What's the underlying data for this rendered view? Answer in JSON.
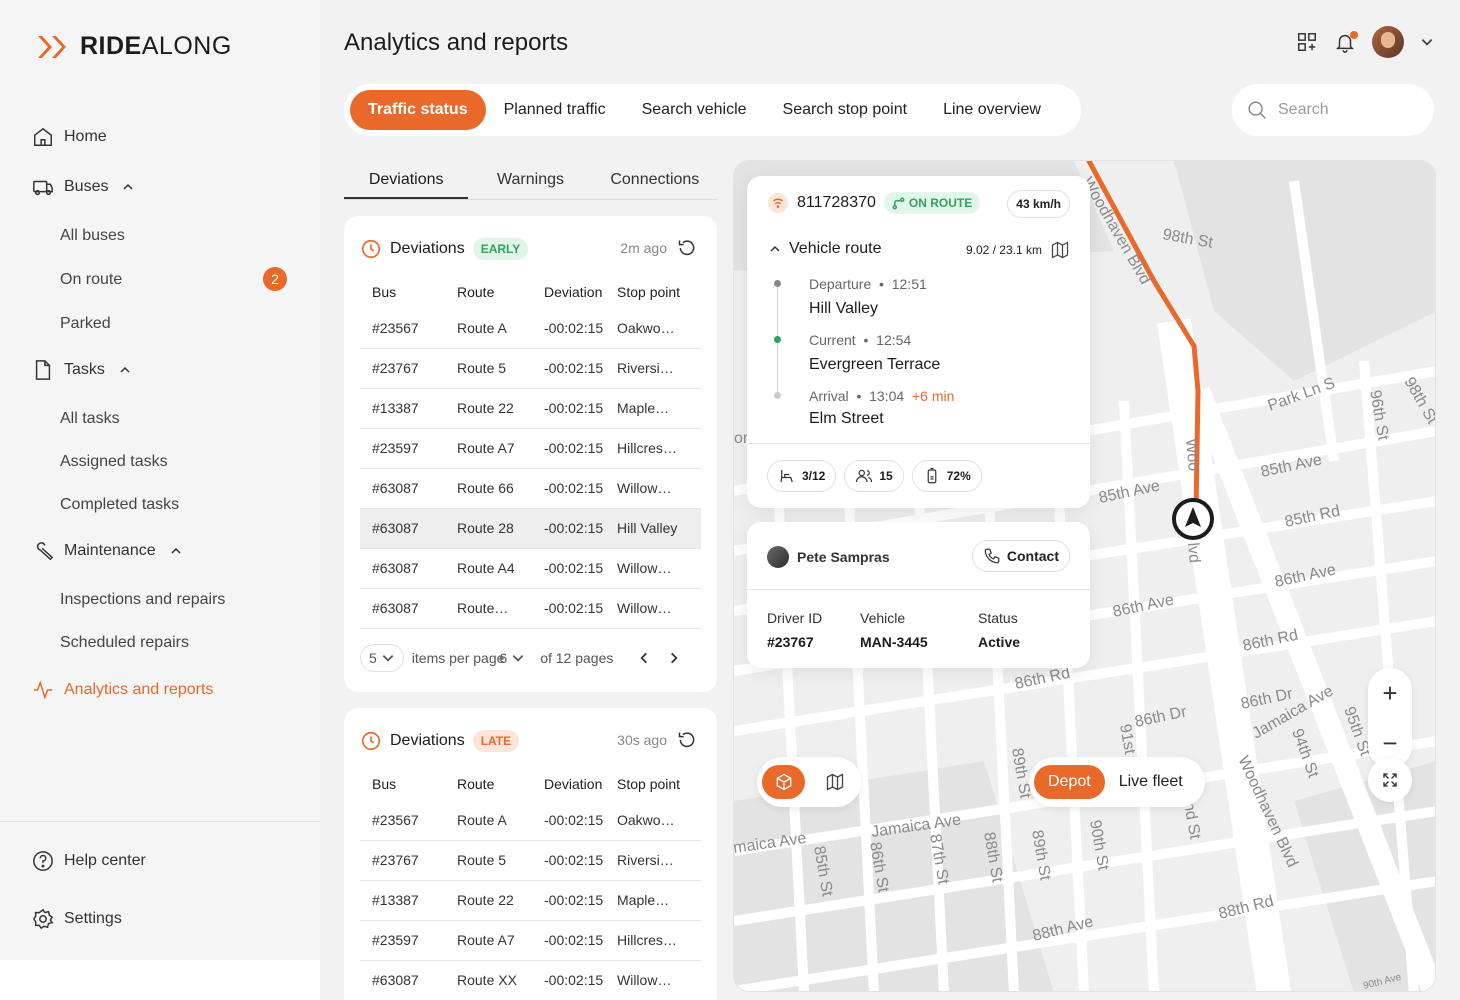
{
  "brand": {
    "logo_bold": "RIDE",
    "logo_light": "ALONG"
  },
  "sidebar": {
    "home": "Home",
    "buses": "Buses",
    "all_buses": "All buses",
    "on_route": "On route",
    "on_route_count": "2",
    "parked": "Parked",
    "tasks": "Tasks",
    "all_tasks": "All tasks",
    "assigned_tasks": "Assigned tasks",
    "completed_tasks": "Completed tasks",
    "maintenance": "Maintenance",
    "inspections": "Inspections and repairs",
    "scheduled_repairs": "Scheduled repairs",
    "analytics": "Analytics and reports",
    "help": "Help center",
    "settings": "Settings"
  },
  "header": {
    "title": "Analytics and reports"
  },
  "tabs": [
    "Traffic status",
    "Planned traffic",
    "Search vehicle",
    "Search stop point",
    "Line overview"
  ],
  "search": {
    "placeholder": "Search"
  },
  "subtabs": [
    "Deviations",
    "Warnings",
    "Connections"
  ],
  "table_headers": [
    "Bus",
    "Route",
    "Deviation",
    "Stop point"
  ],
  "card_early": {
    "title": "Deviations",
    "badge": "EARLY",
    "updated": "2m ago",
    "rows": [
      [
        "#23567",
        "Route A",
        "-00:02:15",
        "Oakwo…"
      ],
      [
        "#23767",
        "Route 5",
        "-00:02:15",
        "Riversi…"
      ],
      [
        "#13387",
        "Route 22",
        "-00:02:15",
        "Maple…"
      ],
      [
        "#23597",
        "Route A7",
        "-00:02:15",
        "Hillcres…"
      ],
      [
        "#63087",
        "Route 66",
        "-00:02:15",
        "Willow…"
      ],
      [
        "#63087",
        "Route 28",
        "-00:02:15",
        "Hill Valley"
      ],
      [
        "#63087",
        "Route A4",
        "-00:02:15",
        "Willow…"
      ],
      [
        "#63087",
        "Route…",
        "-00:02:15",
        "Willow…"
      ]
    ],
    "pager": {
      "per_page": "5",
      "per_page_label": "items per page",
      "page": "6",
      "of_pages": "of 12 pages"
    }
  },
  "card_late": {
    "title": "Deviations",
    "badge": "LATE",
    "updated": "30s ago",
    "rows": [
      [
        "#23567",
        "Route A",
        "-00:02:15",
        "Oakwo…"
      ],
      [
        "#23767",
        "Route 5",
        "-00:02:15",
        "Riversi…"
      ],
      [
        "#13387",
        "Route 22",
        "-00:02:15",
        "Maple…"
      ],
      [
        "#23597",
        "Route A7",
        "-00:02:15",
        "Hillcres…"
      ],
      [
        "#63087",
        "Route XX",
        "-00:02:15",
        "Willow…"
      ]
    ]
  },
  "vehicle": {
    "id": "811728370",
    "status": "ON ROUTE",
    "speed": "43 km/h",
    "route_label": "Vehicle route",
    "distance": "9.02 / 23.1 km",
    "departure_label": "Departure",
    "departure_time": "12:51",
    "departure_stop": "Hill Valley",
    "current_label": "Current",
    "current_time": "12:54",
    "current_stop": "Evergreen Terrace",
    "arrival_label": "Arrival",
    "arrival_time": "13:04",
    "arrival_delay": "+6 min",
    "arrival_stop": "Elm Street",
    "seats": "3/12",
    "passengers": "15",
    "battery": "72%"
  },
  "driver": {
    "name": "Pete Sampras",
    "contact": "Contact",
    "id_label": "Driver ID",
    "id_value": "#23767",
    "vehicle_label": "Vehicle",
    "vehicle_value": "MAN-3445",
    "status_label": "Status",
    "status_value": "Active"
  },
  "map": {
    "fleet_options": [
      "Depot",
      "Live fleet"
    ],
    "streets": [
      "Woodhaven Blvd",
      "98th St",
      "Park Ln S",
      "96th St",
      "98th St",
      "85th Ave",
      "85th Rd",
      "86th Ave",
      "85th Ave",
      "86th Ave",
      "86th Rd",
      "86th Rd",
      "86th Dr",
      "86th Dr",
      "Jamaica Ave",
      "95th St",
      "94th St",
      "91st",
      "89th St",
      "Jamaica Ave",
      "maica Ave",
      "85th St",
      "86th St",
      "87th St",
      "88th St",
      "89th St",
      "90th St",
      "nd St",
      "Woodhaven Blvd",
      "88th Ave",
      "88th Rd",
      "90th Ave",
      "Woo",
      "lvd",
      "or"
    ],
    "accent_route": "#e8692a"
  },
  "colors": {
    "accent": "#e8692a",
    "success": "#2fa35a"
  }
}
